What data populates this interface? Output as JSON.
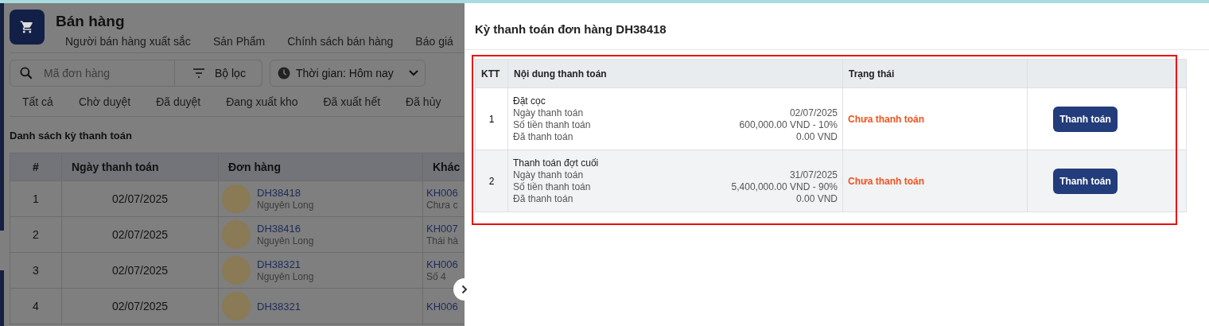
{
  "page": {
    "title": "Bán hàng",
    "nav": [
      "Người bán hàng xuất sắc",
      "Sản Phẩm",
      "Chính sách bán hàng",
      "Báo giá"
    ],
    "search": {
      "placeholder": "Mã đơn hàng"
    },
    "filter": {
      "label": "Bộ lọc"
    },
    "time_select": {
      "value": "Thời gian: Hôm nay"
    },
    "status_tabs": [
      {
        "label": "Tất cả",
        "selected": false
      },
      {
        "label": "Chờ duyệt",
        "selected": false
      },
      {
        "label": "Đã duyệt",
        "selected": false
      },
      {
        "label": "Đang xuất kho",
        "selected": false
      },
      {
        "label": "Đã xuất hết",
        "selected": false
      },
      {
        "label": "Đã hủy",
        "selected": false
      }
    ],
    "section_title": "Danh sách kỳ thanh toán",
    "table": {
      "columns": [
        "#",
        "Ngày thanh toán",
        "Đơn hàng",
        "Khác"
      ],
      "rows": [
        {
          "index": "1",
          "date": "02/07/2025",
          "order": "DH38418",
          "seller": "Nguyên Long",
          "customer": "KH006",
          "customer_note": "Chưa c"
        },
        {
          "index": "2",
          "date": "02/07/2025",
          "order": "DH38416",
          "seller": "Nguyên Long",
          "customer": "KH007",
          "customer_note": "Thái hà"
        },
        {
          "index": "3",
          "date": "02/07/2025",
          "order": "DH38321",
          "seller": "Nguyên Long",
          "customer": "KH006",
          "customer_note": "Số 4"
        },
        {
          "index": "4",
          "date": "02/07/2025",
          "order": "DH38321",
          "seller": "",
          "customer": "KH006",
          "customer_note": ""
        }
      ]
    }
  },
  "drawer": {
    "title": "Kỳ thanh toán đơn hàng DH38418",
    "table": {
      "columns": [
        "KTT",
        "Nội dung thanh toán",
        "Trạng thái"
      ],
      "rows": [
        {
          "index": "1",
          "name": "Đặt cọc",
          "details": [
            {
              "label": "Ngày thanh toán",
              "value": "02/07/2025"
            },
            {
              "label": "Số tiền thanh toán",
              "value": "600,000.00 VND - 10%"
            },
            {
              "label": "Đã thanh toán",
              "value": "0.00 VND"
            }
          ],
          "status": "Chưa thanh toán",
          "action": "Thanh toán"
        },
        {
          "index": "2",
          "name": "Thanh toán đợt cuối",
          "details": [
            {
              "label": "Ngày thanh toán",
              "value": "31/07/2025"
            },
            {
              "label": "Số tiền thanh toán",
              "value": "5,400,000.00 VND - 90%"
            },
            {
              "label": "Đã thanh toán",
              "value": "0.00 VND"
            }
          ],
          "status": "Chưa thanh toán",
          "action": "Thanh toán"
        }
      ]
    }
  }
}
